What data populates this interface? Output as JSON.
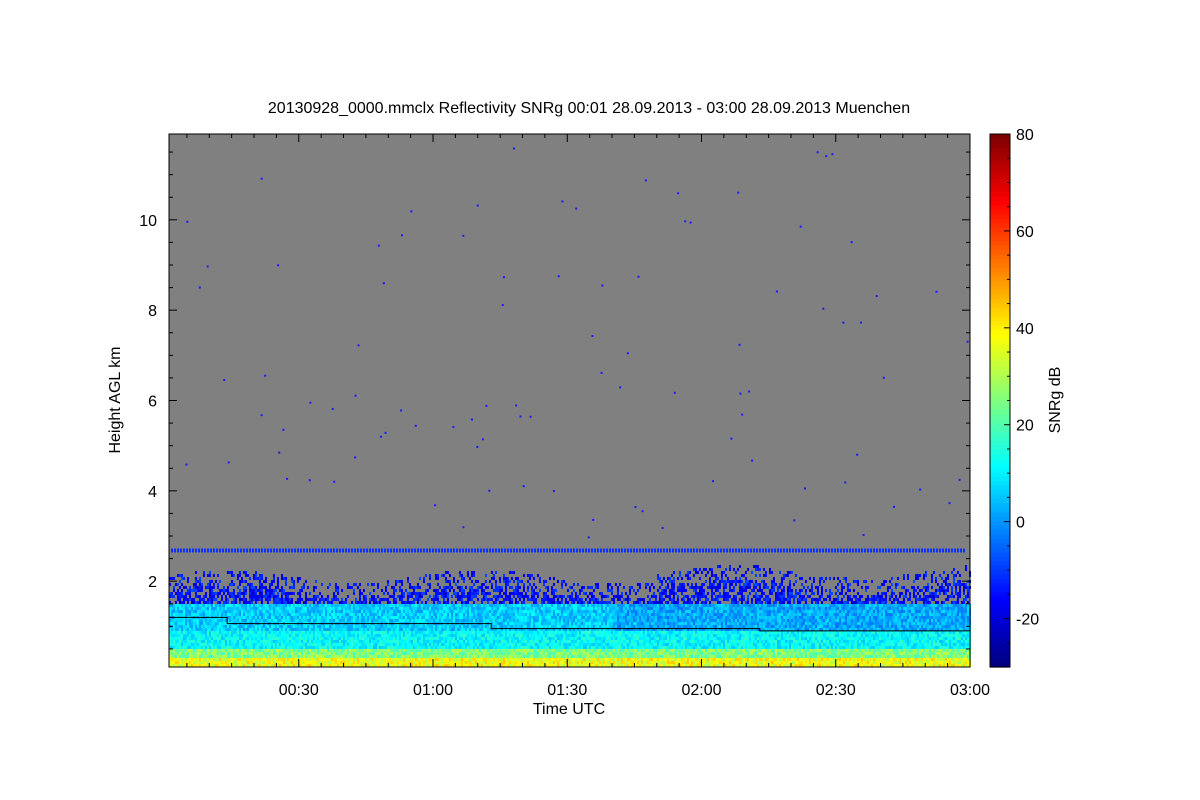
{
  "chart_data": {
    "type": "heatmap",
    "title": "20130928_0000.mmclx Reflectivity SNRg   00:01 28.09.2013 - 03:00 28.09.2013 Muenchen",
    "xlabel": "Time UTC",
    "ylabel": "Height AGL km",
    "colorbar_label": "SNRg dB",
    "x_range_minutes": [
      1,
      180
    ],
    "y_range_km": [
      0.1,
      11.9
    ],
    "x_ticks": [
      {
        "value": 30,
        "label": "00:30"
      },
      {
        "value": 60,
        "label": "01:00"
      },
      {
        "value": 90,
        "label": "01:30"
      },
      {
        "value": 120,
        "label": "02:00"
      },
      {
        "value": 150,
        "label": "02:30"
      },
      {
        "value": 180,
        "label": "03:00"
      }
    ],
    "y_ticks": [
      {
        "value": 2,
        "label": "2"
      },
      {
        "value": 4,
        "label": "4"
      },
      {
        "value": 6,
        "label": "6"
      },
      {
        "value": 8,
        "label": "8"
      },
      {
        "value": 10,
        "label": "10"
      }
    ],
    "colorbar_range_db": [
      -30,
      80
    ],
    "colorbar_ticks": [
      {
        "value": -20,
        "label": "-20"
      },
      {
        "value": 0,
        "label": "0"
      },
      {
        "value": 20,
        "label": "20"
      },
      {
        "value": 40,
        "label": "40"
      },
      {
        "value": 60,
        "label": "60"
      },
      {
        "value": 80,
        "label": "80"
      }
    ],
    "background_color": "#808080",
    "features": {
      "echo_top_km": 2.0,
      "artifact_line_km": 2.68,
      "sensitivity_line": [
        [
          1,
          1.2
        ],
        [
          14,
          1.2
        ],
        [
          14,
          1.06
        ],
        [
          73,
          1.06
        ],
        [
          73,
          0.95
        ],
        [
          133,
          0.95
        ],
        [
          133,
          0.9
        ],
        [
          180,
          0.9
        ]
      ]
    }
  }
}
